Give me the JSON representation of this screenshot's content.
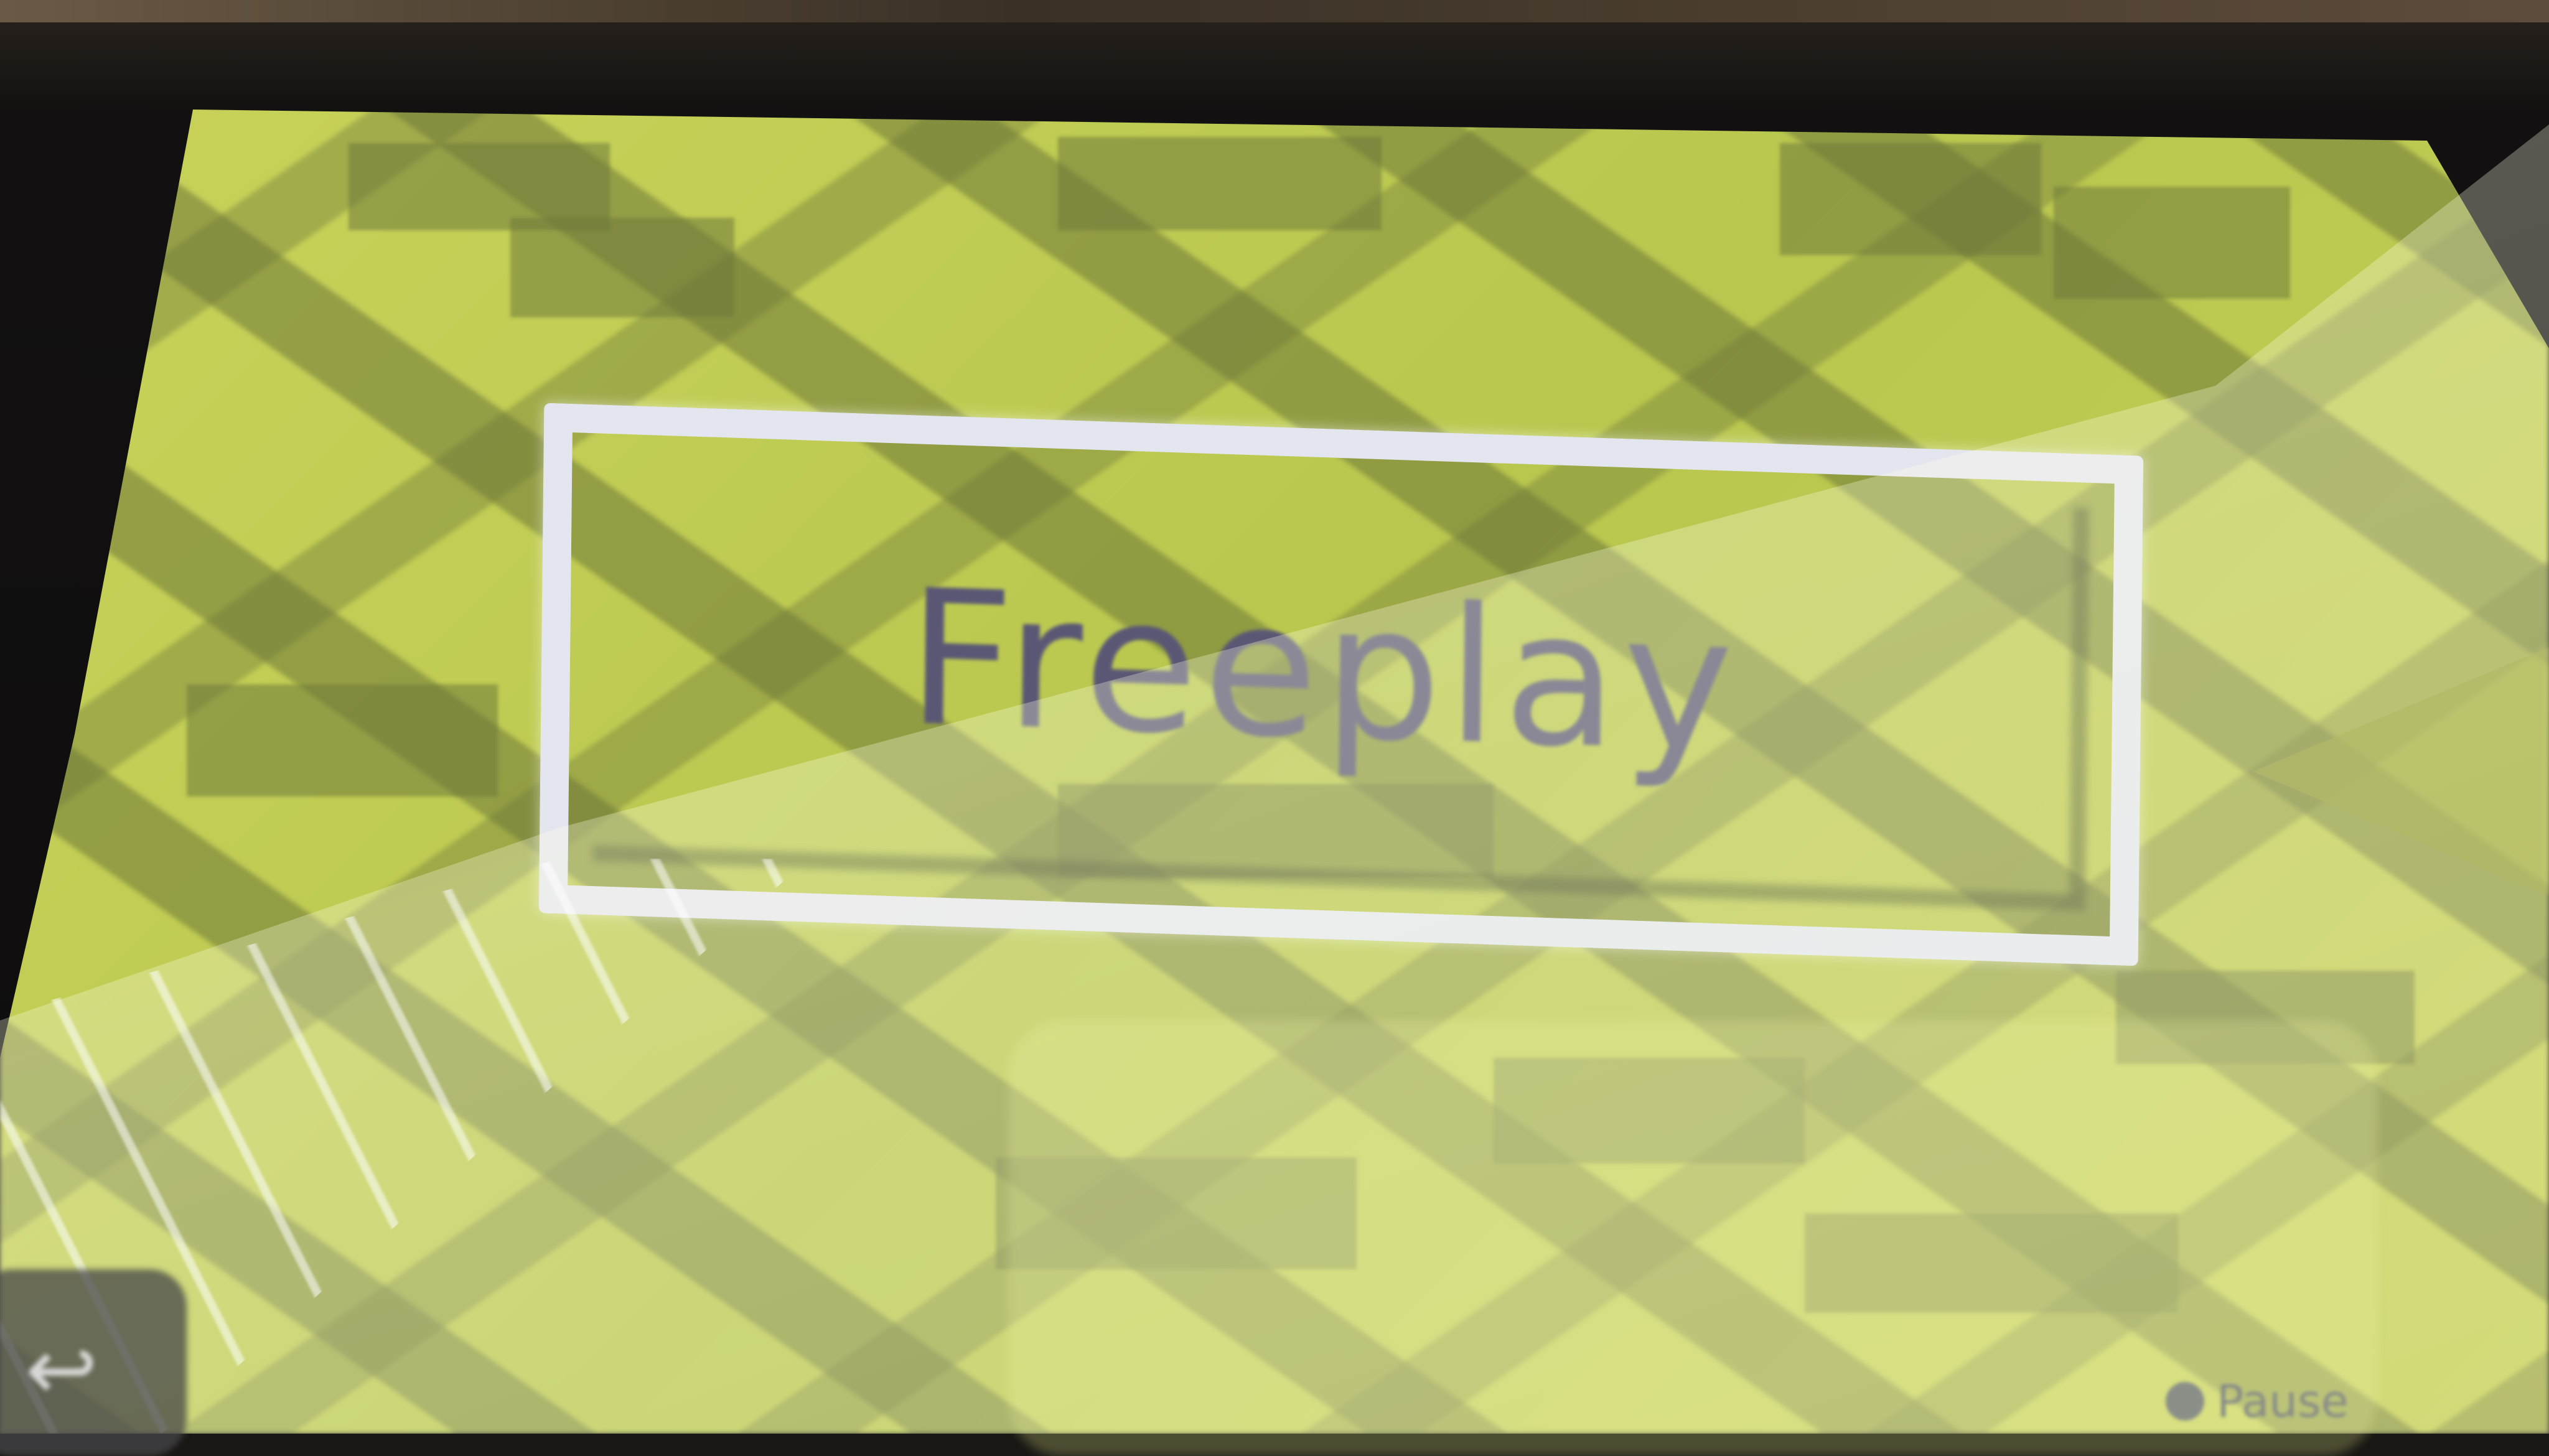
{
  "screen": {
    "main_button_label": "Freeplay",
    "pause_label": "Pause",
    "corner_icon": "back-icon",
    "accent_colors": {
      "background": "#bfcc52",
      "pattern": "#707a3a",
      "button_border": "#e4e6ef",
      "label": "#5a5775"
    }
  }
}
